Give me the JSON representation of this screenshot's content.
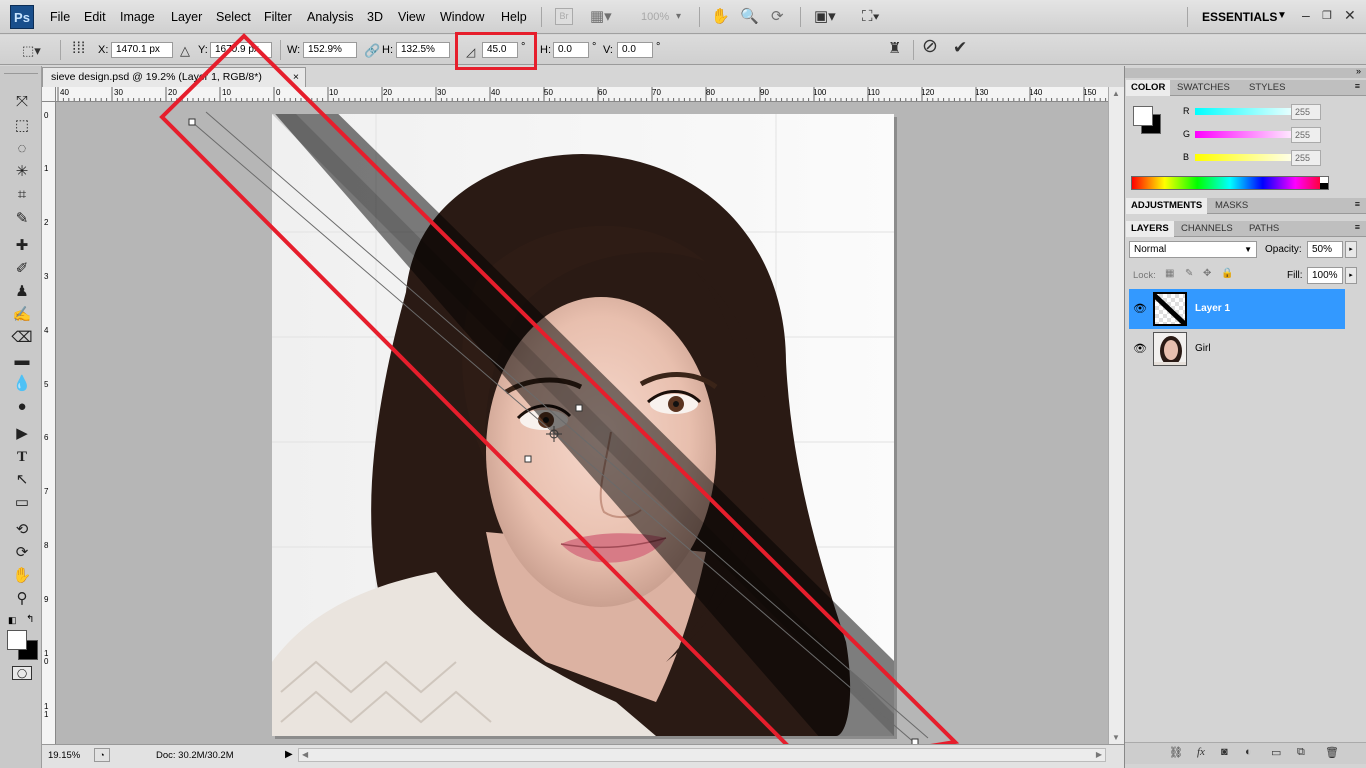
{
  "menubar": {
    "logo": "Ps",
    "items": [
      "File",
      "Edit",
      "Image",
      "Layer",
      "Select",
      "Filter",
      "Analysis",
      "3D",
      "View",
      "Window",
      "Help"
    ],
    "bridge_label": "Br",
    "zoom_level": "100%",
    "workspace": "ESSENTIALS",
    "window_controls": [
      "–",
      "❐",
      "✕"
    ]
  },
  "options": {
    "x_label": "X:",
    "x_value": "1470.1 px",
    "y_label": "Y:",
    "y_value": "1670.9 px",
    "w_label": "W:",
    "w_value": "152.9%",
    "h_label": "H:",
    "h_value": "132.5%",
    "angle_value": "45.0",
    "degree_sign": "°",
    "hskew_label": "H:",
    "hskew_value": "0.0",
    "vskew_label": "V:",
    "vskew_value": "0.0",
    "cancel_icon": "⊘",
    "commit_icon": "✔"
  },
  "document": {
    "tab_title": "sieve design.psd @ 19.2% (Layer 1, RGB/8*)",
    "tab_close": "×",
    "ruler_h": [
      "40",
      "30",
      "20",
      "10",
      "0",
      "10",
      "20",
      "30",
      "40",
      "50",
      "60",
      "70",
      "80",
      "90",
      "100",
      "110",
      "120",
      "130",
      "140",
      "150"
    ],
    "ruler_v": [
      "0",
      "1",
      "2",
      "3",
      "4",
      "5",
      "6",
      "7",
      "8",
      "9",
      "1 0",
      "1 1"
    ]
  },
  "status": {
    "zoom": "19.15%",
    "doc_size": "Doc: 30.2M/30.2M"
  },
  "color_panel": {
    "tabs": [
      "COLOR",
      "SWATCHES",
      "STYLES"
    ],
    "channels": [
      {
        "label": "R",
        "value": "255",
        "color": "#00ffff"
      },
      {
        "label": "G",
        "value": "255",
        "color": "#ff00ff"
      },
      {
        "label": "B",
        "value": "255",
        "color": "#ffff00"
      }
    ]
  },
  "adjustments_panel": {
    "tabs": [
      "ADJUSTMENTS",
      "MASKS"
    ]
  },
  "layers_panel": {
    "tabs": [
      "LAYERS",
      "CHANNELS",
      "PATHS"
    ],
    "blend_mode": "Normal",
    "opacity_label": "Opacity:",
    "opacity_value": "50%",
    "lock_label": "Lock:",
    "fill_label": "Fill:",
    "fill_value": "100%",
    "layers": [
      {
        "name": "Layer 1",
        "selected": true
      },
      {
        "name": "Girl",
        "selected": false
      }
    ],
    "selected_color": "#3399ff"
  }
}
